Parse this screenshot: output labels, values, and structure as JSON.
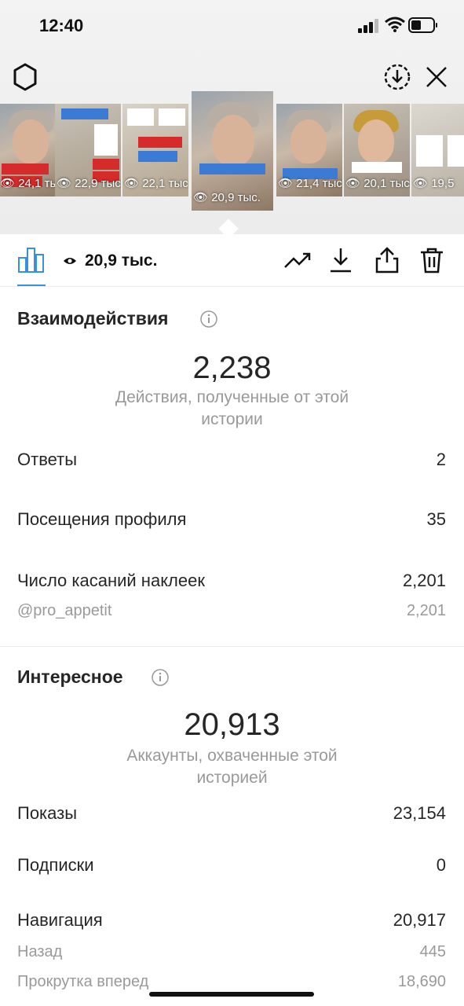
{
  "status_bar": {
    "time": "12:40"
  },
  "stories": [
    {
      "views": "24,1 тыс."
    },
    {
      "views": "22,9 тыс."
    },
    {
      "views": "22,1 тыс."
    },
    {
      "views": "20,9 тыс.",
      "active": true
    },
    {
      "views": "21,4 тыс."
    },
    {
      "views": "20,1 тыс."
    },
    {
      "views": "19,5"
    }
  ],
  "toolbar": {
    "views_label": "20,9 тыс."
  },
  "interactions": {
    "title": "Взаимодействия",
    "total": "2,238",
    "description": "Действия, полученные от этой истории",
    "rows": [
      {
        "label": "Ответы",
        "value": "2"
      },
      {
        "label": "Посещения профиля",
        "value": "35"
      },
      {
        "label": "Число касаний наклеек",
        "value": "2,201"
      }
    ],
    "sub_row": {
      "label": "@pro_appetit",
      "value": "2,201"
    }
  },
  "discovery": {
    "title": "Интересное",
    "total": "20,913",
    "description": "Аккаунты, охваченные этой историей",
    "rows": [
      {
        "label": "Показы",
        "value": "23,154"
      },
      {
        "label": "Подписки",
        "value": "0"
      },
      {
        "label": "Навигация",
        "value": "20,917"
      }
    ],
    "sub_rows": [
      {
        "label": "Назад",
        "value": "445"
      },
      {
        "label": "Прокрутка вперед",
        "value": "18,690"
      }
    ]
  },
  "colors": {
    "accent": "#3b8fe0",
    "text": "#262626",
    "muted": "#999999"
  }
}
